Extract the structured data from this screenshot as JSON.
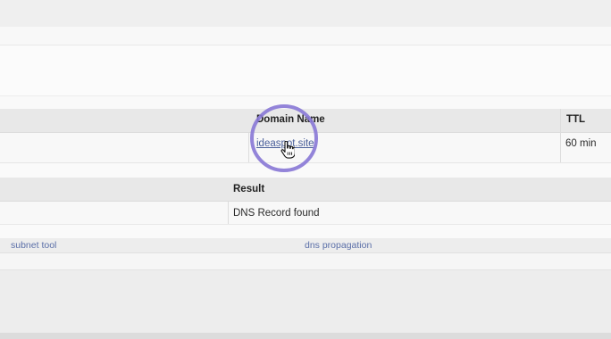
{
  "dns_table": {
    "headers": {
      "domain_name": "Domain Name",
      "ttl": "TTL"
    },
    "row": {
      "domain": "ideaspot.site",
      "ttl": "60 min"
    }
  },
  "result_table": {
    "header": "Result",
    "value": "DNS Record found"
  },
  "footer_links": {
    "subnet_tool": "subnet tool",
    "dns_propagation": "dns propagation"
  },
  "overlay": {
    "highlight_color": "#8a7ad6",
    "cursor_icon": "hand-pointer-icon"
  }
}
